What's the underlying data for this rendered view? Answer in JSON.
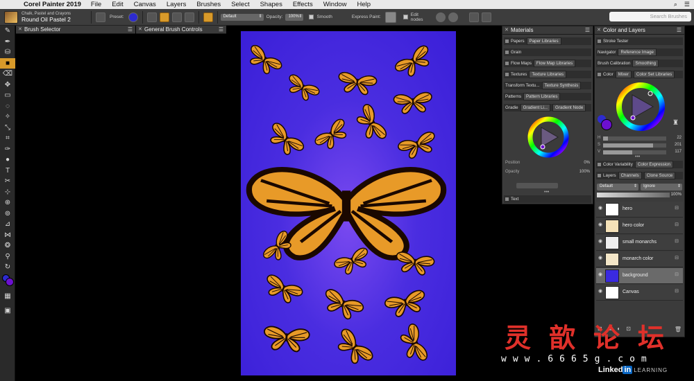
{
  "menubar": {
    "app_name": "Corel Painter 2019",
    "items": [
      "File",
      "Edit",
      "Canvas",
      "Layers",
      "Brushes",
      "Select",
      "Shapes",
      "Effects",
      "Window",
      "Help"
    ]
  },
  "propbar": {
    "brush_category": "Chalk, Pastel and Crayons",
    "brush_variant": "Round Oil Pastel 2",
    "preset_label": "Preset:",
    "blend_mode": "Default",
    "opacity_label": "Opacity:",
    "opacity_value": "100%",
    "smooth_label": "Smooth",
    "express_paint_label": "Express Paint:",
    "edit_nodes_label": "Edit nodes",
    "search_placeholder": "Search Brushes"
  },
  "panels": {
    "brush_selector": "Brush Selector",
    "general_brush_controls": "General Brush Controls",
    "materials": {
      "title": "Materials",
      "rows": [
        {
          "label": "Papers",
          "tab": "Paper Libraries"
        },
        {
          "label": "Grain",
          "tab": ""
        },
        {
          "label": "Flow Maps",
          "tab": "Flow Map Libraries"
        },
        {
          "label": "Textures",
          "tab": "Texture Libraries"
        },
        {
          "label": "Transform Textu...",
          "tab": "Texture Synthesis"
        },
        {
          "label": "Patterns",
          "tab": "Pattern Libraries"
        },
        {
          "label": "Gradie",
          "tab": "Gradient Li...",
          "tab2": "Gradient Node"
        }
      ],
      "position_label": "Position",
      "position_value": "0%",
      "opacity_label": "Opacity",
      "opacity_value": "100%",
      "text_label": "Text"
    },
    "color_and_layers": {
      "title": "Color and Layers",
      "rows": [
        {
          "label": "Stroke Tester",
          "tab": ""
        },
        {
          "label": "Navigator",
          "tab": "Reference Image"
        },
        {
          "label": "Brush Calibration",
          "tab": "Smoothing"
        },
        {
          "label": "Color",
          "tab": "Mixer",
          "tab2": "Color Set Libraries"
        }
      ],
      "hsv": [
        {
          "label": "H",
          "value": "22"
        },
        {
          "label": "S",
          "value": "201"
        },
        {
          "label": "V",
          "value": "117"
        }
      ],
      "variability_row": {
        "label": "Color Variability",
        "tab": "Color Expression"
      },
      "layers_row": {
        "label": "Layers",
        "tab": "Channels",
        "tab2": "Clone Source"
      },
      "composite_method": "Default",
      "composite_depth": "Ignore",
      "layer_opacity": "100%",
      "layers": [
        {
          "name": "hero",
          "selected": false
        },
        {
          "name": "hero color",
          "selected": false
        },
        {
          "name": "small monarchs",
          "selected": false
        },
        {
          "name": "monarch color",
          "selected": false
        },
        {
          "name": "background",
          "selected": true
        },
        {
          "name": "Canvas",
          "selected": false
        }
      ]
    }
  },
  "colors": {
    "primary": "#2d2bd0",
    "secondary": "#6c10d0",
    "accent": "#d89a2a",
    "canvas_bg": "#4a2de0"
  },
  "watermark": {
    "chinese": "灵歆论坛",
    "url": "www.6665g.com",
    "brand": "Linked",
    "brand_in": "in",
    "brand_suffix": "LEARNING"
  }
}
